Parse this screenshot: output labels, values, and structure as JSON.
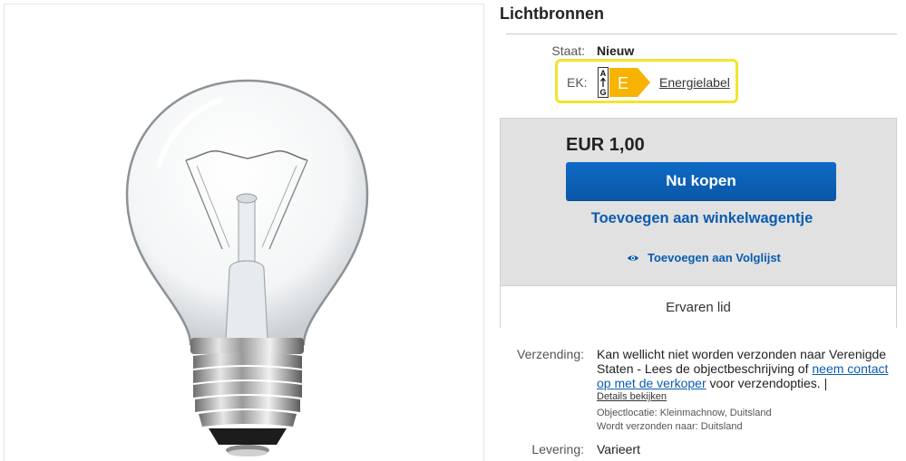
{
  "product": {
    "title": "Lichtbronnen"
  },
  "condition": {
    "label": "Staat:",
    "value": "Nieuw"
  },
  "energy": {
    "label": "EK:",
    "scale_top": "A",
    "scale_bottom": "G",
    "class": "E",
    "link": "Energielabel",
    "highlight_color": "#f2e52c",
    "class_color": "#f7b300"
  },
  "purchase": {
    "price": "EUR 1,00",
    "buy_now": "Nu kopen",
    "add_to_cart": "Toevoegen aan winkelwagentje",
    "add_to_watchlist": "Toevoegen aan Volglijst",
    "seller_badge": "Ervaren lid",
    "accent_color": "#0b5cb0"
  },
  "shipping": {
    "label": "Verzending:",
    "text_before_link": "Kan wellicht niet worden verzonden naar Verenigde Staten - Lees de objectbeschrijving of ",
    "contact_link": "neem contact op met de verkoper",
    "text_after_link": " voor verzendopties. |",
    "details_link": "Details bekijken",
    "item_location": "Objectlocatie:  Kleinmachnow, Duitsland",
    "ships_to": "Wordt verzonden naar:  Duitsland"
  },
  "delivery": {
    "label": "Levering:",
    "value": "Varieert"
  },
  "image": {
    "icon": "light-bulb"
  }
}
